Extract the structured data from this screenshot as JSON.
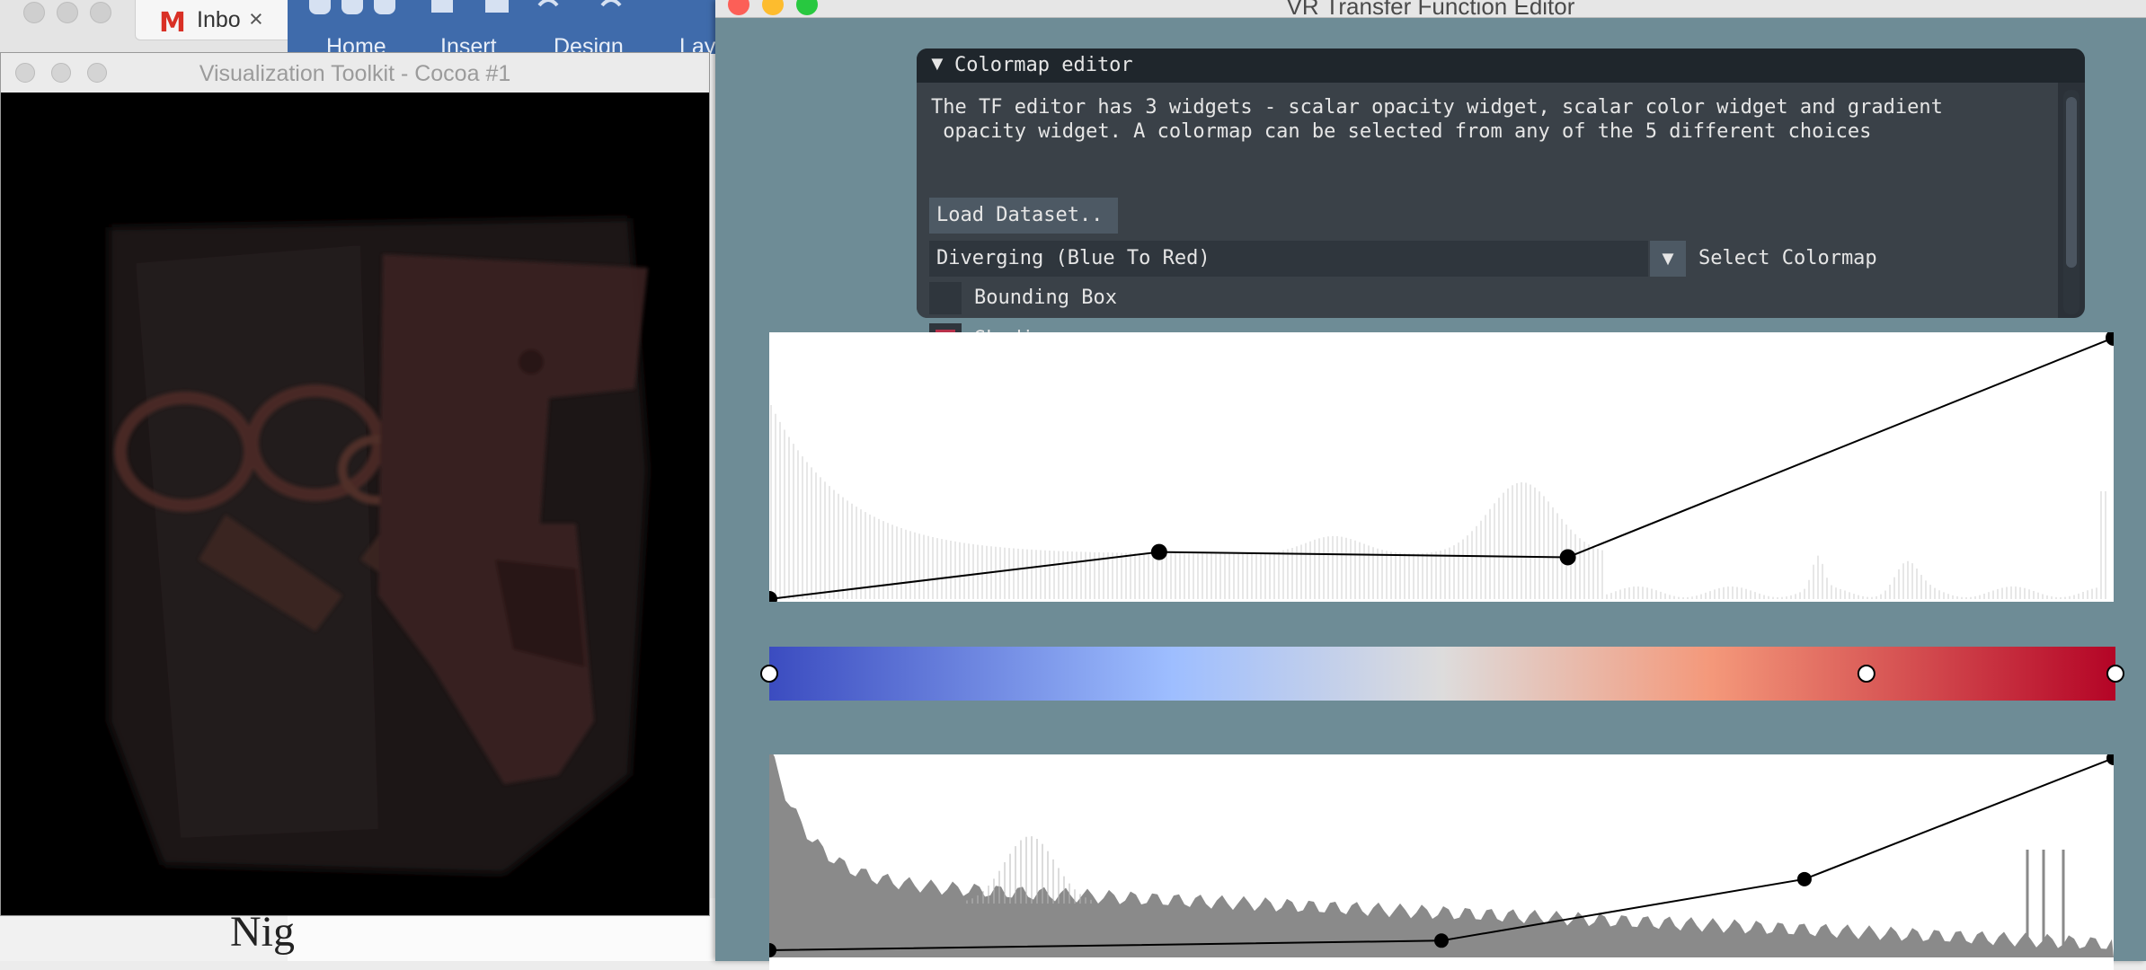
{
  "browser": {
    "tab_title": "Inbo",
    "tab_close": "×",
    "gmail_glyph": "M"
  },
  "word": {
    "tabs": [
      "Home",
      "Insert",
      "Design",
      "Lay"
    ],
    "doc_text": "Nig"
  },
  "vtk_window": {
    "title": "Visualization Toolkit - Cocoa #1"
  },
  "tf_window": {
    "title": "VR Transfer Function Editor",
    "panel": {
      "header": "Colormap editor",
      "header_arrow": "▼",
      "description_line1": "The TF editor has 3 widgets - scalar opacity widget, scalar color widget and gradient",
      "description_line2": " opacity widget. A colormap can be selected from any of the 5 different choices",
      "load_button": "Load Dataset..",
      "colormap_value": "Diverging (Blue To Red)",
      "colormap_arrow": "▼",
      "colormap_label": "Select Colormap",
      "bounding_box_label": "Bounding Box",
      "bounding_box_checked": false,
      "shading_label": "Shading",
      "shading_checked": true
    },
    "colors": {
      "window_bg": "#6e8c96",
      "colormap_stops": [
        "#3b4cc0",
        "#9ebeff",
        "#dddcdc",
        "#f4987a",
        "#b40426"
      ],
      "checked_color": "#b8304a"
    },
    "scalar_opacity_points": [
      [
        0.0,
        0.0
      ],
      [
        0.29,
        0.18
      ],
      [
        0.594,
        0.16
      ],
      [
        1.0,
        1.0
      ]
    ],
    "color_points": [
      0.0,
      0.815,
      1.0
    ],
    "gradient_opacity_points": [
      [
        0.0,
        0.0
      ],
      [
        0.5,
        0.05
      ],
      [
        0.77,
        0.37
      ],
      [
        1.0,
        1.0
      ]
    ]
  }
}
